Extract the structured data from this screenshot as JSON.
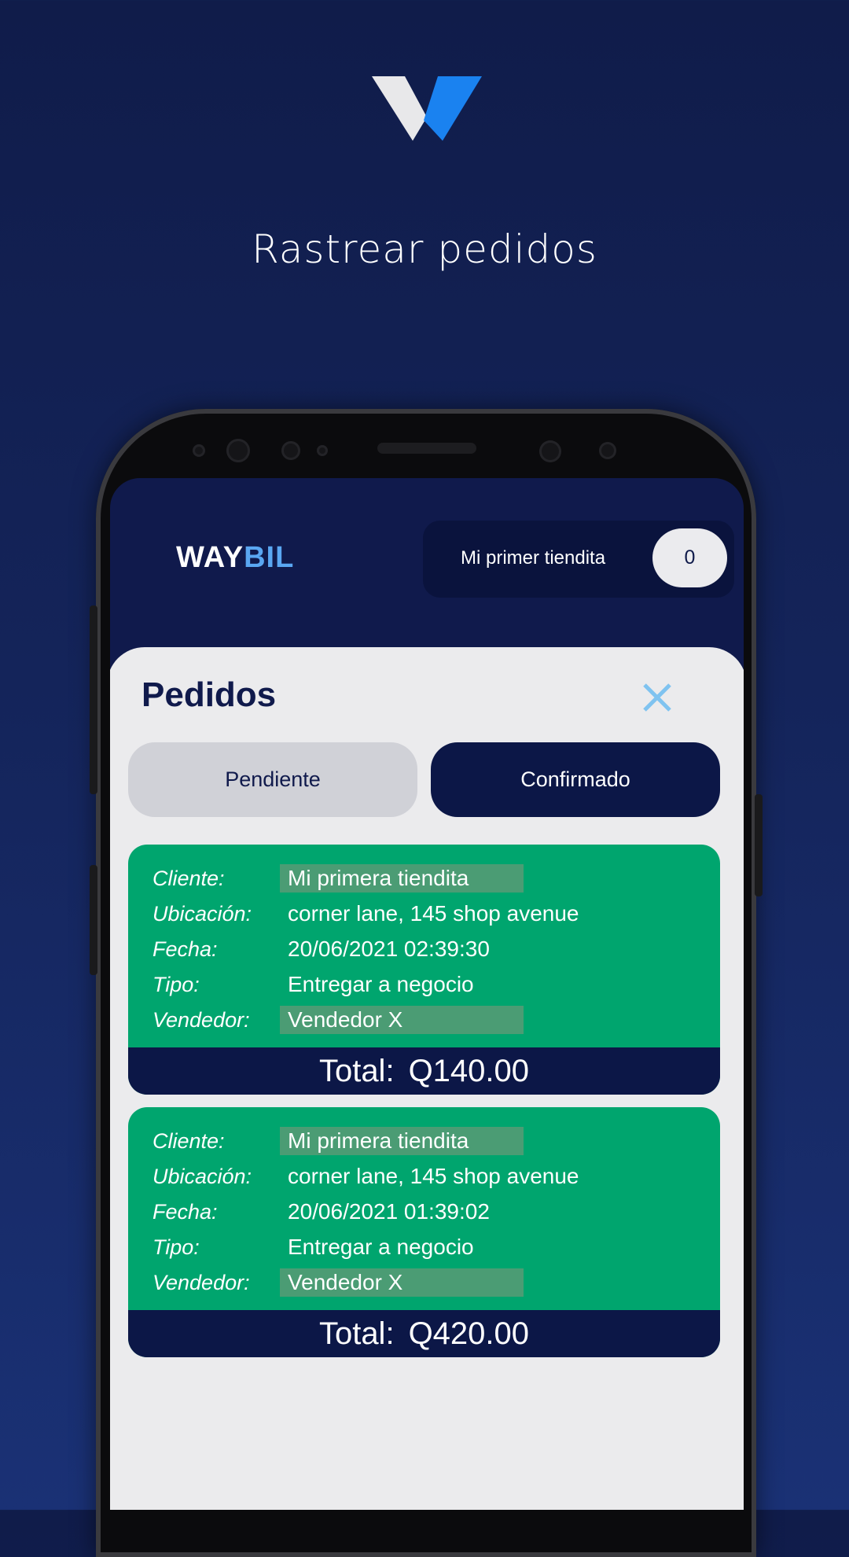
{
  "headline": "Rastrear pedidos",
  "app": {
    "brand_part1": "WAY",
    "brand_part2": "BIL",
    "store_name": "Mi primer tiendita",
    "order_count": "0"
  },
  "orders_panel": {
    "title": "Pedidos",
    "tabs": [
      {
        "label": "Pendiente",
        "active": false
      },
      {
        "label": "Confirmado",
        "active": true
      }
    ],
    "labels": {
      "client": "Cliente:",
      "location": "Ubicación:",
      "date": "Fecha:",
      "type": "Tipo:",
      "seller": "Vendedor:",
      "total": "Total:"
    },
    "orders": [
      {
        "client": "Mi primera tiendita",
        "location": "corner lane, 145 shop avenue",
        "date": "20/06/2021 02:39:30",
        "type": "Entregar a negocio",
        "seller": "Vendedor X",
        "total": "Q140.00"
      },
      {
        "client": "Mi primera tiendita",
        "location": "corner lane, 145 shop avenue",
        "date": "20/06/2021 01:39:02",
        "type": "Entregar a negocio",
        "seller": "Vendedor X",
        "total": "Q420.00"
      }
    ]
  },
  "colors": {
    "background": "#14245a",
    "card_green": "#00a56e",
    "navy": "#0c1747",
    "accent_blue": "#5aa7f2",
    "close_icon": "#7fc3f0"
  },
  "icons": [
    "waybil-logo-icon",
    "close-icon"
  ]
}
